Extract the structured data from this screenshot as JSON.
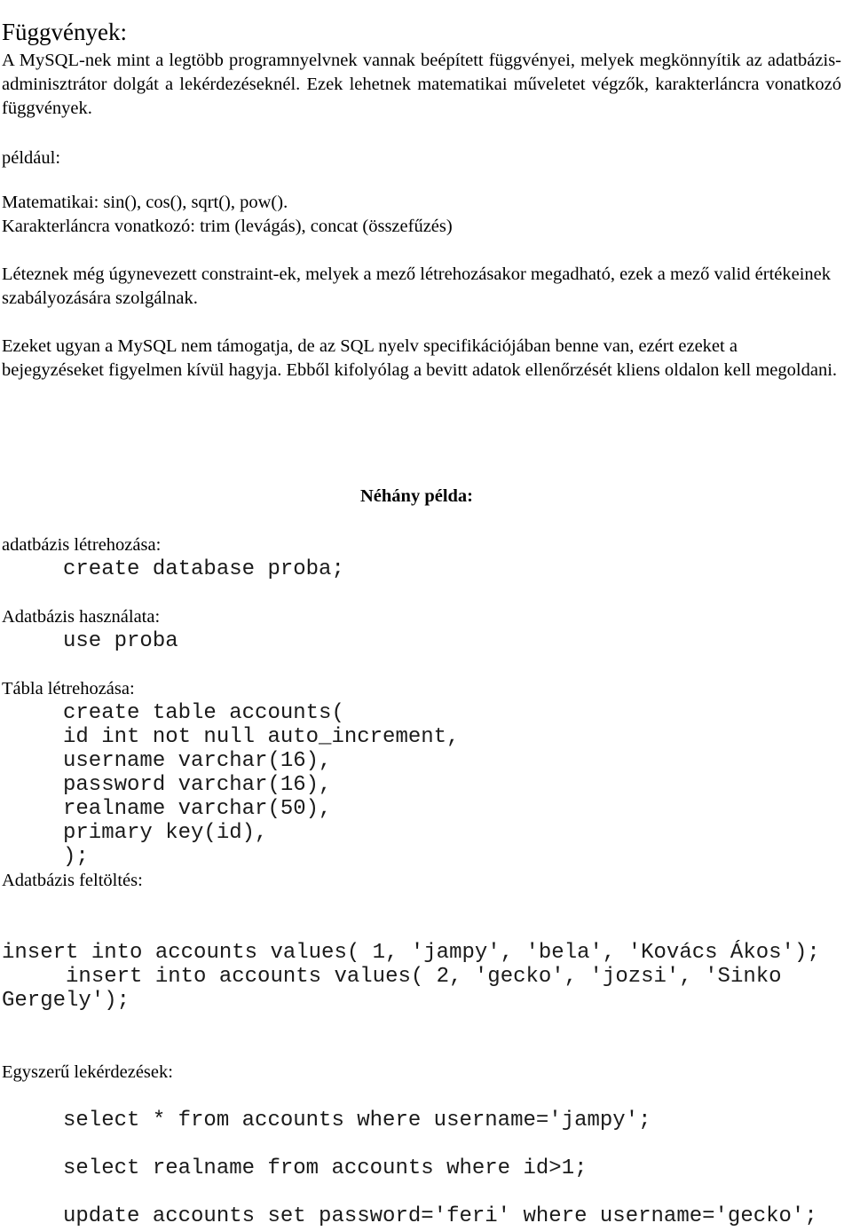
{
  "document": {
    "language": "hu",
    "title": "Függvények:",
    "background_color": "#ffffff",
    "text_color": "#000000"
  },
  "sections": {
    "intro": {
      "paragraph": "A MySQL-nek mint a legtöbb programnyelvnek vannak beépített függvényei, melyek megkönnyítik az adatbázis-adminisztrátor dolgát a lekérdezéseknél. Ezek lehetnek matematikai műveletet végzők, karakterláncra vonatkozó függvények.",
      "example_label": "például:",
      "math_line": "Matematikai: sin(), cos(), sqrt(), pow().",
      "string_line": "Karakterláncra vonatkozó: trim (levágás), concat (összefűzés)"
    },
    "constraints": {
      "paragraph_1": "Léteznek még úgynevezett constraint-ek, melyek a mező létrehozásakor megadható, ezek a mező valid értékeinek szabályozására szolgálnak.",
      "paragraph_2": "Ezeket ugyan a MySQL nem támogatja, de az SQL nyelv specifikációjában benne van, ezért ezeket a bejegyzéseket figyelmen kívül hagyja. Ebből kifolyólag a bevitt adatok ellenőrzését kliens oldalon kell megoldani."
    },
    "examples": {
      "heading": "Néhány példa:",
      "blocks": [
        {
          "label": "adatbázis létrehozása:",
          "code": "create database proba;"
        },
        {
          "label": "Adatbázis használata:",
          "code": "use proba"
        },
        {
          "label": "Tábla létrehozása:",
          "code": "create table accounts(\nid int not null auto_increment,\nusername varchar(16),\npassword varchar(16),\nrealname varchar(50),\nprimary key(id),\n);"
        },
        {
          "label": "Adatbázis feltöltés:",
          "code": "insert into accounts values( 1, 'jampy', 'bela', 'Kovács Ákos');\n     insert into accounts values( 2, 'gecko', 'jozsi', 'Sinko Gergely');"
        },
        {
          "label": "Egyszerű lekérdezések:",
          "code_lines": [
            "select * from accounts where username='jampy';",
            "select realname from accounts where id>1;",
            "update accounts set password='feri' where username='gecko';"
          ]
        }
      ]
    }
  }
}
